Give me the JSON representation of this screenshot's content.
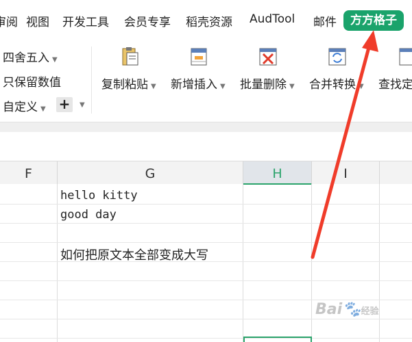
{
  "menu": {
    "items": [
      "审阅",
      "视图",
      "开发工具",
      "会员专享",
      "稻壳资源",
      "AudTool",
      "邮件"
    ],
    "active": "方方格子",
    "active_color": "#1aa36b"
  },
  "ribbon": {
    "round_label": "四舍五入",
    "keep_value_label": "只保留数值",
    "custom_label": "自定义",
    "plus_label": "+",
    "buttons": [
      "复制粘贴",
      "新增插入",
      "批量删除",
      "合并转换",
      "查找定"
    ]
  },
  "sheet": {
    "columns": [
      "F",
      "G",
      "H",
      "I",
      ""
    ],
    "selected_column": "H",
    "cells": {
      "g1": "hello kitty",
      "g2": "good day",
      "g4": "如何把原文本全部变成大写"
    }
  },
  "annotation": {
    "arrow_color": "#f03c2a"
  },
  "watermark": {
    "text": "Bai",
    "suffix": "经验"
  }
}
